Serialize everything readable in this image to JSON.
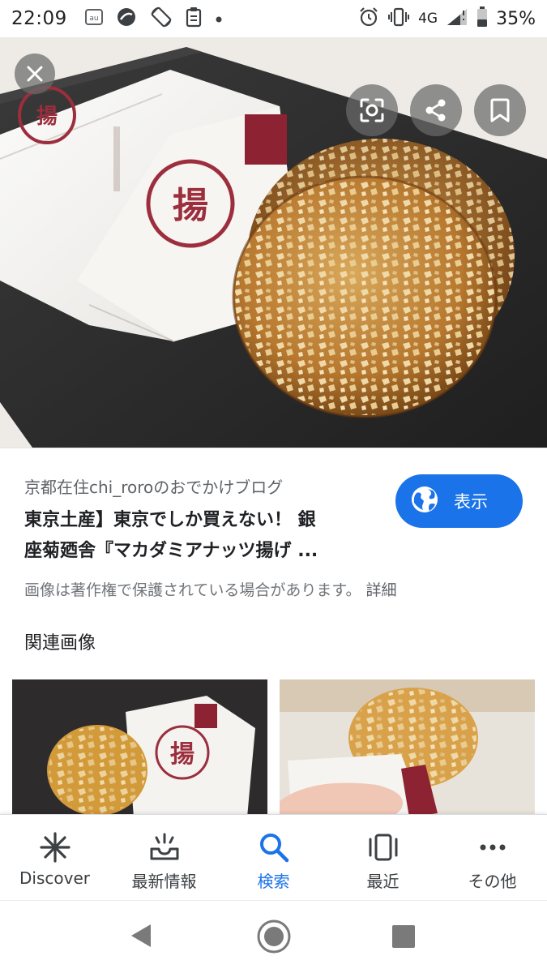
{
  "status_bar": {
    "time": "22:09",
    "left_icons": [
      "au-icon",
      "app-circle-icon",
      "screen-rotate-icon",
      "clipboard-icon",
      "dot-icon"
    ],
    "network_type": "4G",
    "battery_percent": "35%"
  },
  "image_viewer": {
    "close_icon": "close-icon",
    "actions": [
      "lens-icon",
      "share-icon",
      "bookmark-icon"
    ]
  },
  "result": {
    "source": "京都在住chi_roroのおでかけブログ",
    "title_line1": "東京土産】東京でしか買えない！ 銀",
    "title_line2": "座菊廼舎『マカダミアナッツ揚げ ...",
    "visit_label": "表示",
    "copyright_notice": "画像は著作権で保護されている場合があります。",
    "details_link": "詳細"
  },
  "related": {
    "heading": "関連画像"
  },
  "bottom_nav": {
    "items": [
      {
        "label": "Discover",
        "icon": "asterisk-icon",
        "active": false
      },
      {
        "label": "最新情報",
        "icon": "updates-inbox-icon",
        "active": false
      },
      {
        "label": "検索",
        "icon": "search-icon",
        "active": true
      },
      {
        "label": "最近",
        "icon": "recent-cards-icon",
        "active": false
      },
      {
        "label": "その他",
        "icon": "more-dots-icon",
        "active": false
      }
    ]
  },
  "colors": {
    "accent": "#1a73e8",
    "text_primary": "#202124",
    "text_secondary": "#5f6368"
  }
}
